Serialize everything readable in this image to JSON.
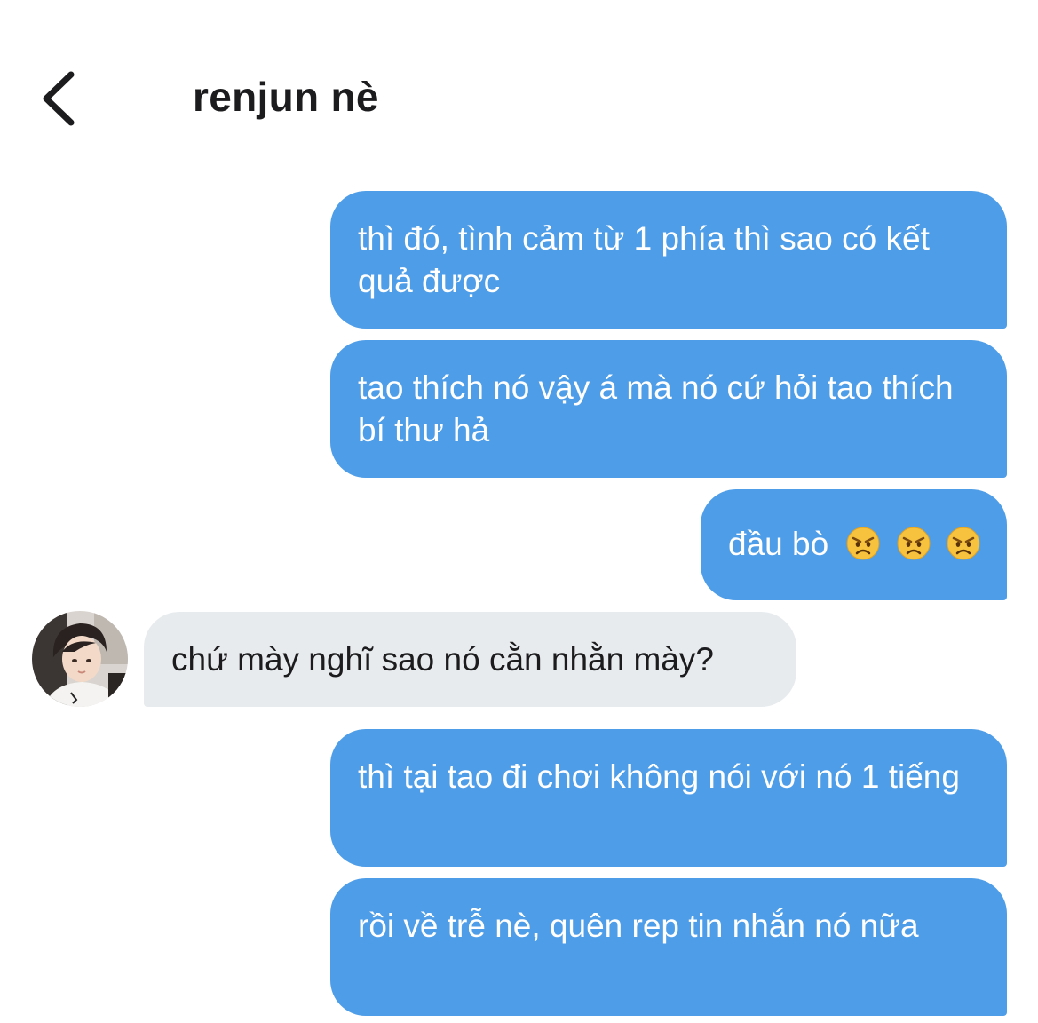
{
  "header": {
    "title": "renjun nè",
    "back_icon": "chevron-left-icon"
  },
  "colors": {
    "sent_bubble": "#4e9de8",
    "received_bubble": "#e8ebee",
    "title_text": "#1c1c1e"
  },
  "messages": [
    {
      "direction": "sent",
      "text": "thì đó, tình cảm từ 1 phía thì sao có kết quả được"
    },
    {
      "direction": "sent",
      "text": "tao thích nó vậy á mà nó cứ hỏi tao thích bí thư hả"
    },
    {
      "direction": "sent",
      "text": "đầu bò",
      "emoji": [
        "angry-face-icon",
        "angry-face-icon",
        "angry-face-icon"
      ]
    },
    {
      "direction": "received",
      "text": "chứ mày nghĩ sao nó cằn nhằn mày?",
      "avatar": "contact-avatar"
    },
    {
      "direction": "sent",
      "text": "thì tại tao đi chơi không nói với nó 1 tiếng"
    },
    {
      "direction": "sent",
      "text": "rồi về trễ nè, quên rep tin nhắn nó nữa"
    }
  ]
}
